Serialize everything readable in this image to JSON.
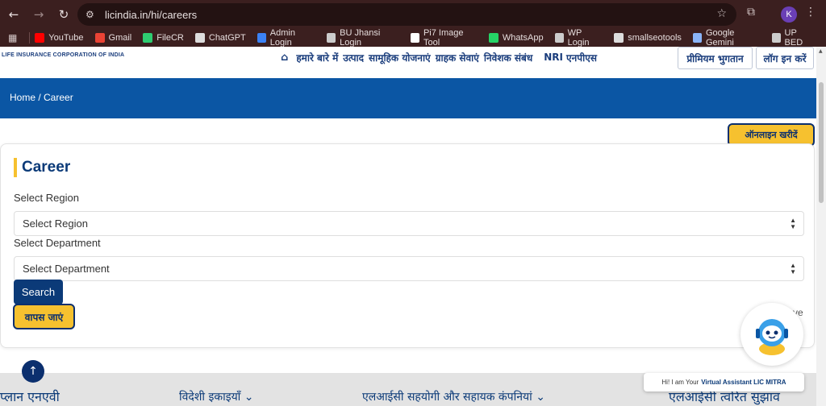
{
  "browser": {
    "url": "licindia.in/hi/careers",
    "profile_initial": "K",
    "bookmarks": [
      {
        "label": "YouTube",
        "color": "#ff0000"
      },
      {
        "label": "Gmail",
        "color": "#ea4335"
      },
      {
        "label": "FileCR",
        "color": "#2ecc71"
      },
      {
        "label": "ChatGPT",
        "color": "#dddddd"
      },
      {
        "label": "Admin Login",
        "color": "#3b82f6"
      },
      {
        "label": "BU Jhansi Login",
        "color": "#cccccc"
      },
      {
        "label": "Pi7 Image Tool",
        "color": "#ffffff"
      },
      {
        "label": "WhatsApp",
        "color": "#25d366"
      },
      {
        "label": "WP Login",
        "color": "#cccccc"
      },
      {
        "label": "smallseotools",
        "color": "#dddddd"
      },
      {
        "label": "Google Gemini",
        "color": "#8ab4f8"
      },
      {
        "label": "UP BED",
        "color": "#cccccc"
      }
    ]
  },
  "header": {
    "logo_text": "LIFE INSURANCE CORPORATION OF INDIA",
    "nav": [
      "हमारे बारे में",
      "उत्पाद",
      "सामूहिक योजनाएं",
      "ग्राहक सेवाएं",
      "निवेशक संबंध",
      "NRI",
      "एनपीएस"
    ],
    "premium_pay": "प्रीमियम भुगतान",
    "login": "लॉग इन करें"
  },
  "breadcrumb": "Home / Career",
  "buy_online": "ऑनलाइन खरीदें",
  "career": {
    "title": "Career",
    "region_label": "Select Region",
    "region_value": "Select Region",
    "department_label": "Select Department",
    "department_value": "Select Department",
    "search_label": "Search",
    "back_label": "वापस जाएं",
    "stray_text": "ve"
  },
  "footer": {
    "items": [
      "प्लान एनएवी",
      "विदेशी इकाइयाँ",
      "एलआईसी सहयोगी और सहायक कंपनियां",
      "एलआईसी त्वरित सुझाव"
    ]
  },
  "assistant": {
    "greeting": "Hi! I am Your",
    "name": "Virtual Assistant LIC MITRA"
  },
  "colors": {
    "brand_blue": "#0b56a4",
    "navy": "#0b3a78",
    "accent_yellow": "#f6c12f"
  }
}
